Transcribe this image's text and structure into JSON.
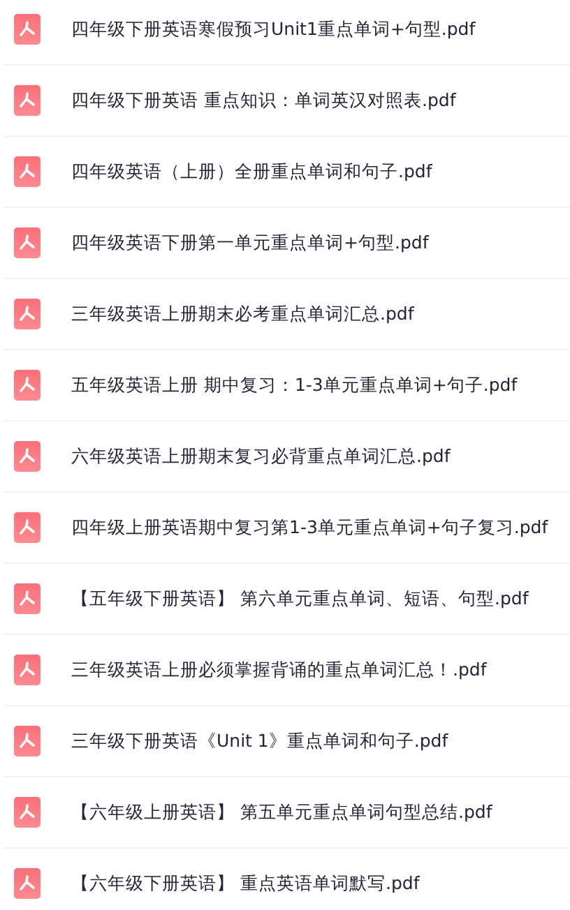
{
  "files": [
    {
      "name": "四年级下册英语寒假预习Unit1重点单词+句型.pdf"
    },
    {
      "name": "四年级下册英语 重点知识：单词英汉对照表.pdf"
    },
    {
      "name": "四年级英语（上册）全册重点单词和句子.pdf"
    },
    {
      "name": "四年级英语下册第一单元重点单词+句型.pdf"
    },
    {
      "name": "三年级英语上册期末必考重点单词汇总.pdf"
    },
    {
      "name": "五年级英语上册 期中复习：1-3单元重点单词+句子.pdf"
    },
    {
      "name": "六年级英语上册期末复习必背重点单词汇总.pdf"
    },
    {
      "name": "四年级上册英语期中复习第1-3单元重点单词+句子复习.pdf"
    },
    {
      "name": "【五年级下册英语】 第六单元重点单词、短语、句型.pdf"
    },
    {
      "name": "三年级英语上册必须掌握背诵的重点单词汇总！.pdf"
    },
    {
      "name": "三年级下册英语《Unit 1》重点单词和句子.pdf"
    },
    {
      "name": "【六年级上册英语】 第五单元重点单词句型总结.pdf"
    },
    {
      "name": "【六年级下册英语】 重点英语单词默写.pdf"
    }
  ]
}
